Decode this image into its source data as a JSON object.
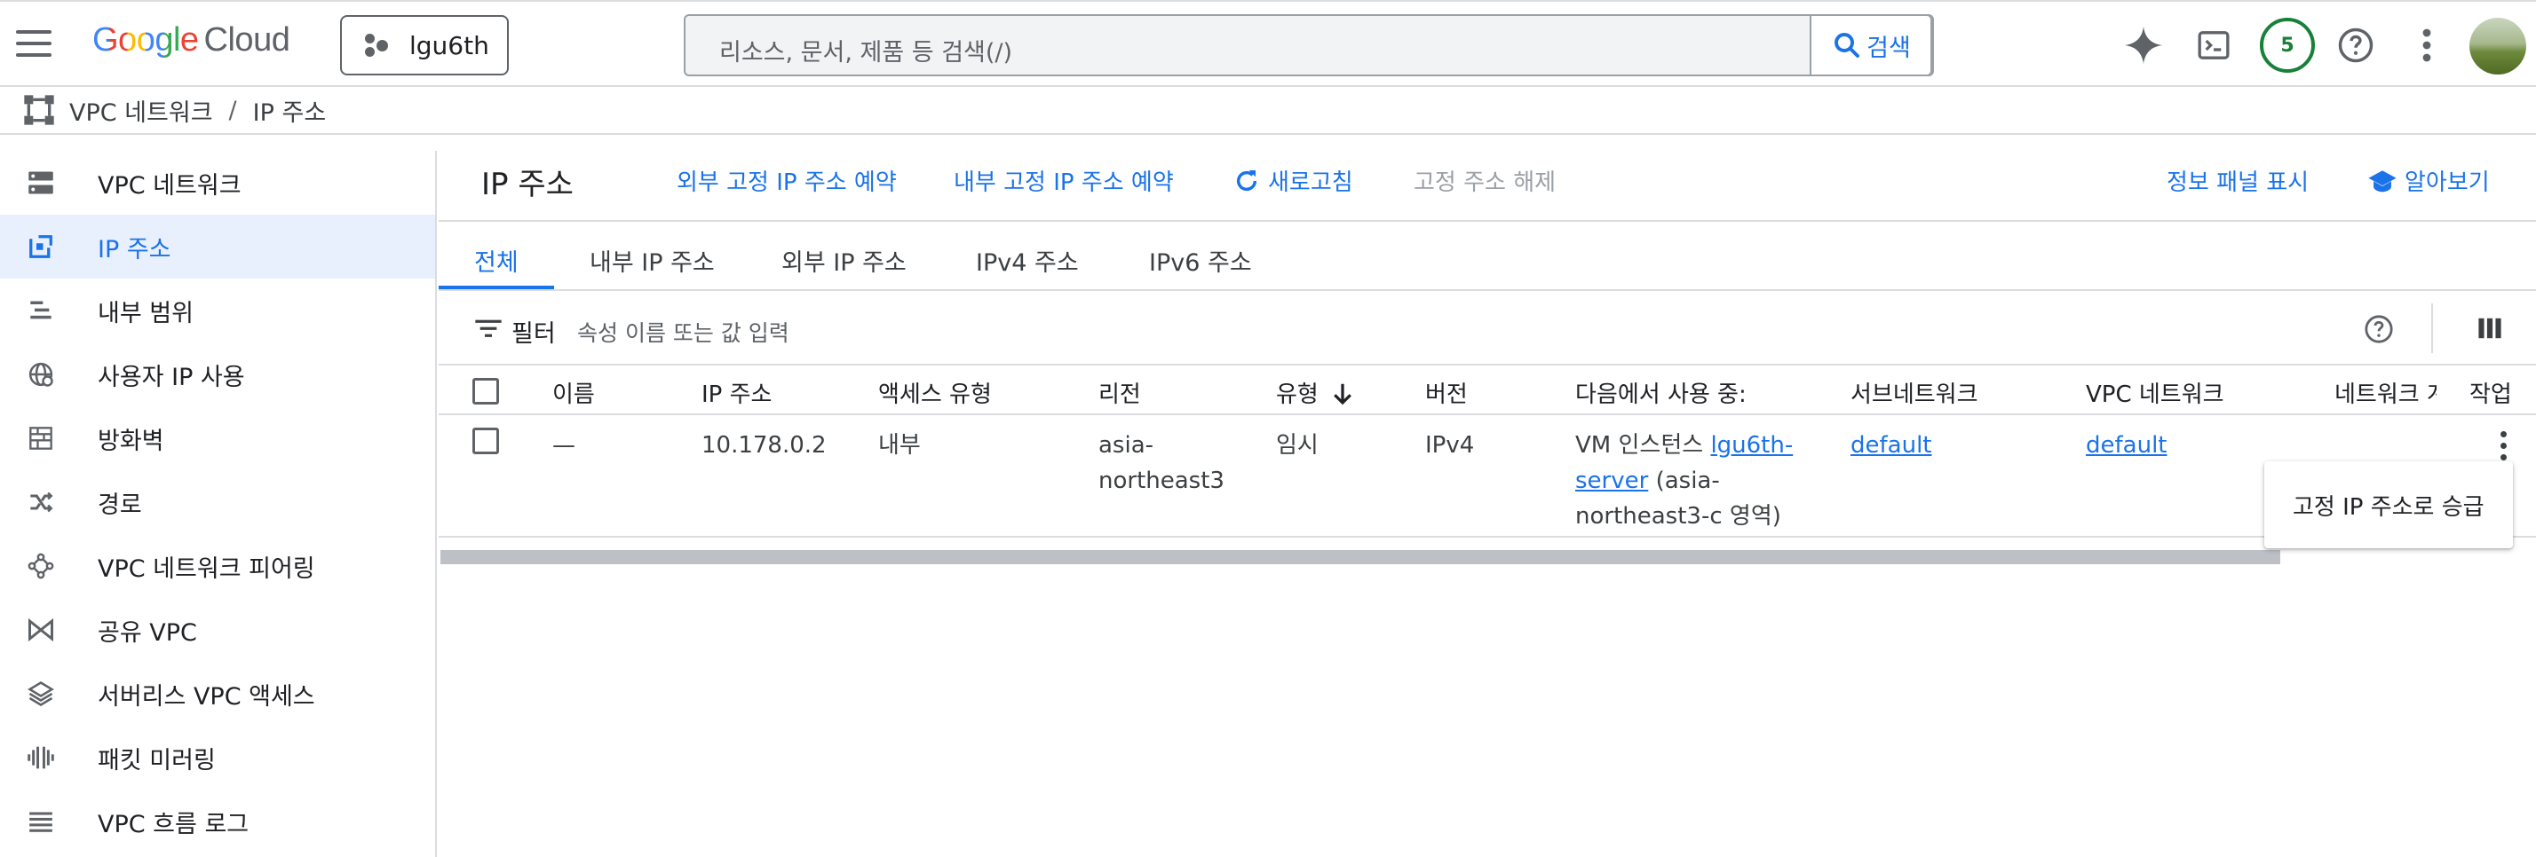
{
  "header": {
    "logo_google": "Google",
    "logo_cloud": "Cloud",
    "project": "lgu6th",
    "search_placeholder": "리소스, 문서, 제품 등 검색(/)",
    "search_button": "검색",
    "notification_count": "5"
  },
  "breadcrumb": {
    "root": "VPC 네트워크",
    "separator": "/",
    "current": "IP 주소"
  },
  "sidebar": {
    "items": [
      {
        "label": "VPC 네트워크",
        "icon": "vpc-network-icon"
      },
      {
        "label": "IP 주소",
        "icon": "ip-address-icon",
        "active": true
      },
      {
        "label": "내부 범위",
        "icon": "internal-range-icon"
      },
      {
        "label": "사용자 IP 사용",
        "icon": "globe-icon"
      },
      {
        "label": "방화벽",
        "icon": "firewall-icon"
      },
      {
        "label": "경로",
        "icon": "routes-icon"
      },
      {
        "label": "VPC 네트워크 피어링",
        "icon": "peering-icon"
      },
      {
        "label": "공유 VPC",
        "icon": "shared-vpc-icon"
      },
      {
        "label": "서버리스 VPC 액세스",
        "icon": "serverless-icon"
      },
      {
        "label": "패킷 미러링",
        "icon": "packet-mirroring-icon"
      },
      {
        "label": "VPC 흐름 로그",
        "icon": "flow-logs-icon"
      }
    ]
  },
  "page": {
    "title": "IP 주소",
    "actions": {
      "reserve_external": "외부 고정 IP 주소 예약",
      "reserve_internal": "내부 고정 IP 주소 예약",
      "refresh": "새로고침",
      "release": "고정 주소 해제",
      "info_panel": "정보 패널 표시",
      "learn": "알아보기"
    },
    "tabs": [
      "전체",
      "내부 IP 주소",
      "외부 IP 주소",
      "IPv4 주소",
      "IPv6 주소"
    ],
    "filter": {
      "label": "필터",
      "placeholder": "속성 이름 또는 값 입력"
    }
  },
  "table": {
    "columns": {
      "name": "이름",
      "ip": "IP 주소",
      "access": "액세스 유형",
      "region": "리전",
      "type": "유형",
      "version": "버전",
      "used_by": "다음에서 사용 중:",
      "subnet": "서브네트워크",
      "vpc": "VPC 네트워크",
      "network_tier": "네트워크 계",
      "actions": "작업"
    },
    "rows": [
      {
        "name": "—",
        "ip": "10.178.0.2",
        "access": "내부",
        "region_line1": "asia-",
        "region_line2": "northeast3",
        "type": "임시",
        "version": "IPv4",
        "used_by_prefix": "VM 인스턴스 ",
        "used_by_link1": "lgu6th-",
        "used_by_link2": "server",
        "used_by_suffix1": " (asia-",
        "used_by_suffix2": "northeast3-c 영역)",
        "subnet": "default",
        "vpc": "default"
      }
    ]
  },
  "context_menu": {
    "promote": "고정 IP 주소로 승급"
  },
  "colors": {
    "accent": "#1a73e8",
    "active_bg": "#e8f0fe",
    "notif": "#188038"
  }
}
